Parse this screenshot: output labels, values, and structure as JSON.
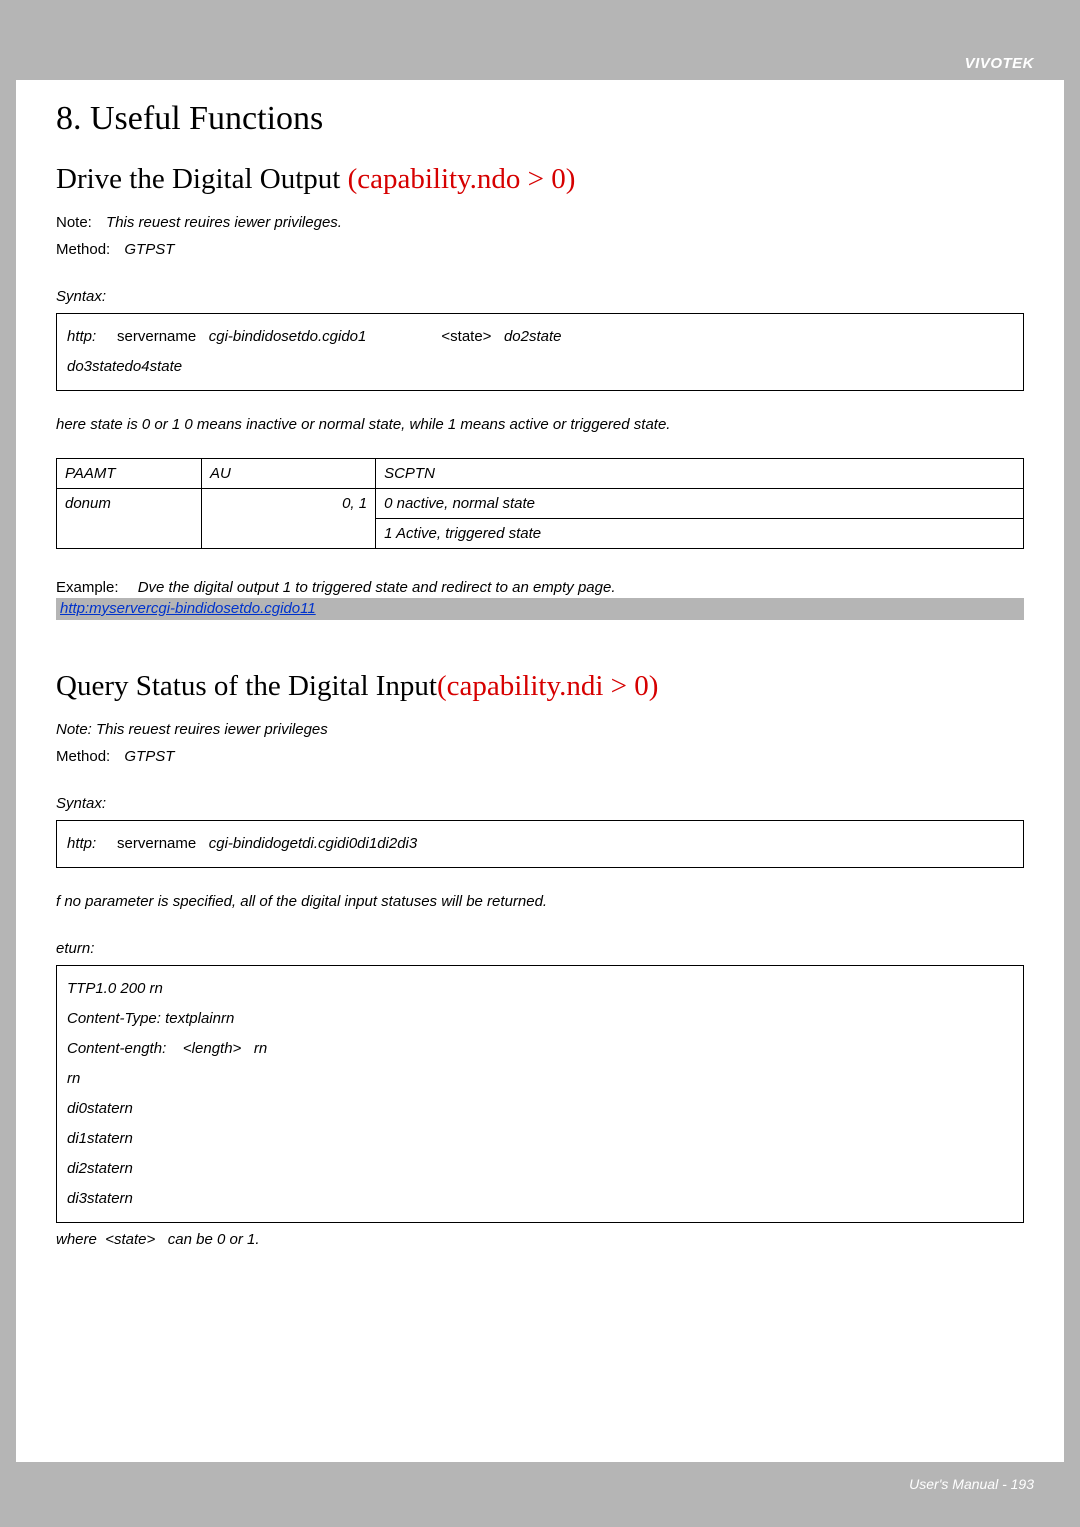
{
  "brand": "VIVOTEK",
  "h1": "8. Useful Functions",
  "section1": {
    "heading_text": "Drive the Digital Output ",
    "heading_cap": "(capability.ndo > 0)",
    "note_label": "Note:",
    "note_text": "This reuest reuires iewer privileges.",
    "method_label": "Method:",
    "method_text": "GTPST",
    "syntax_label": "Syntax:",
    "syntax_line1_a": "http:",
    "syntax_line1_b": "servername",
    "syntax_line1_c": "cgi-bindidosetdo.cgido1",
    "syntax_line1_d": "<state>",
    "syntax_line1_e": "do2state",
    "syntax_line2": "do3statedo4state",
    "body1": "here state is 0 or 1 0 means inactive or normal state, while 1 means active or triggered state.",
    "table": {
      "h1": "PAAMT",
      "h2": "AU",
      "h3": "SCPTN",
      "r1c1": "donum",
      "r1c2": "0, 1",
      "r1c3": "0  nactive, normal state",
      "r2c3": "1  Active, triggered state"
    },
    "example_label": "Example:",
    "example_text": "Dve the digital output 1 to triggered state and redirect to an empty page.",
    "example_link": "http:myservercgi-bindidosetdo.cgido11"
  },
  "section2": {
    "heading_text": "Query Status of the Digital Input",
    "heading_cap": "(capability.ndi > 0)",
    "note_full": "Note: This reuest reuires iewer privileges",
    "method_label": "Method:",
    "method_text": "GTPST",
    "syntax_label": "Syntax:",
    "syntax_a": "http:",
    "syntax_b": "servername",
    "syntax_c": "cgi-bindidogetdi.cgidi0di1di2di3",
    "body1": "f no parameter is specified, all of the digital input statuses will be returned.",
    "return_label": "eturn:",
    "return_lines": {
      "l1": "TTP1.0 200 rn",
      "l2": "Content-Type: textplainrn",
      "l3a": "Content-ength:",
      "l3b": "<length>",
      "l3c": "rn",
      "l4": "rn",
      "l5": "di0statern",
      "l6": "di1statern",
      "l7": "di2statern",
      "l8": "di3statern"
    },
    "where_a": "where",
    "where_b": "<state>",
    "where_c": "can be 0 or 1."
  },
  "footer": "User's Manual - 193"
}
